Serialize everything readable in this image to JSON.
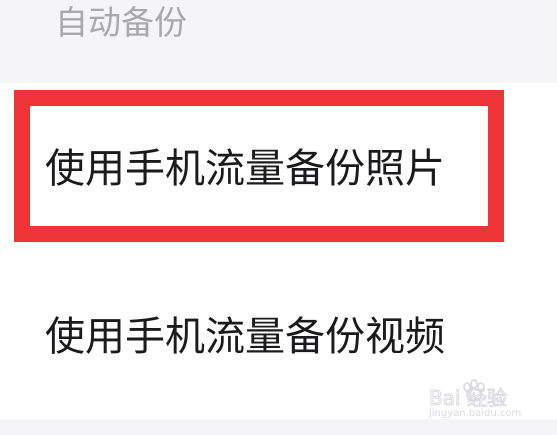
{
  "section": {
    "title": "自动备份"
  },
  "options": [
    {
      "label": "使用手机流量备份照片"
    },
    {
      "label": "使用手机流量备份视频"
    }
  ],
  "watermark": {
    "text": "Bai 经验",
    "subtext": "jingyan.baidu.com"
  },
  "colors": {
    "highlight": "#ee3436",
    "section_bg": "#f5f5f7",
    "section_text": "#a9a9ad",
    "row_text": "#1b1b1d"
  }
}
